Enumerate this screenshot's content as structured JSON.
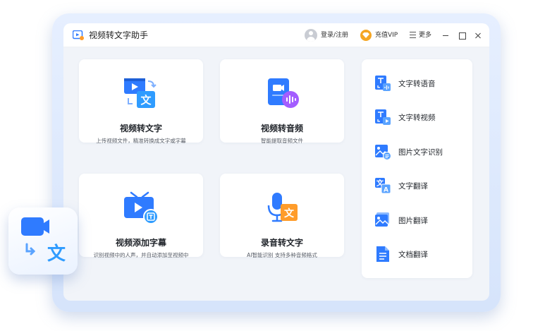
{
  "app": {
    "title": "视频转文字助手"
  },
  "titlebar": {
    "login_label": "登录/注册",
    "vip_label": "充值VIP",
    "more_label": "更多"
  },
  "features": [
    {
      "title": "视频转文字",
      "desc": "上传视频文件，精准转换成文字或字幕",
      "icon": "video-to-text-icon"
    },
    {
      "title": "视频转音频",
      "desc": "智能提取音频文件",
      "icon": "video-to-audio-icon"
    },
    {
      "title": "视频添加字幕",
      "desc": "识别视频中的人声，并自动添加至视频中",
      "icon": "tv-subtitle-icon"
    },
    {
      "title": "录音转文字",
      "desc": "AI智能识别 支持多种音频格式",
      "icon": "microphone-text-icon"
    }
  ],
  "tools": [
    {
      "label": "文字转语音",
      "icon": "text-to-speech-icon"
    },
    {
      "label": "文字转视频",
      "icon": "text-to-video-icon"
    },
    {
      "label": "图片文字识别",
      "icon": "image-ocr-icon"
    },
    {
      "label": "文字翻译",
      "icon": "text-translate-icon"
    },
    {
      "label": "图片翻译",
      "icon": "image-translate-icon"
    },
    {
      "label": "文档翻译",
      "icon": "document-translate-icon"
    }
  ],
  "float_badge": {
    "glyph": "文"
  },
  "colors": {
    "brand_blue": "#2f7bff",
    "accent_orange": "#ff9c2a",
    "accent_purple": "#a35dff",
    "vip_gold": "#f5a623"
  }
}
